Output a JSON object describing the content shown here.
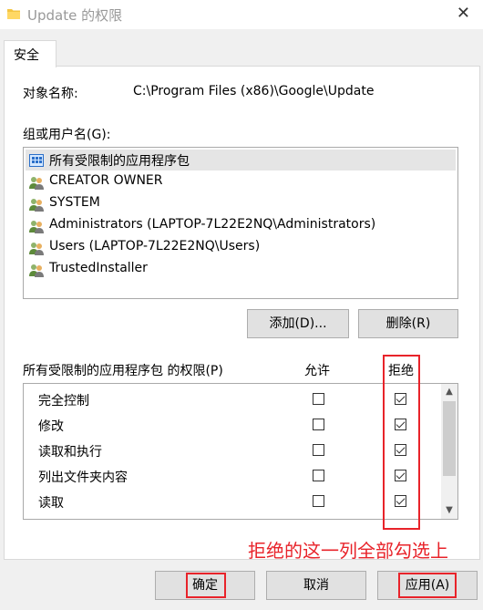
{
  "window": {
    "title": "Update 的权限",
    "close_glyph": "✕"
  },
  "tab": {
    "label": "安全"
  },
  "object": {
    "label": "对象名称:",
    "path": "C:\\Program Files (x86)\\Google\\Update"
  },
  "users": {
    "label": "组或用户名(G):",
    "items": [
      {
        "name": "所有受限制的应用程序包",
        "icon": "app-package-icon",
        "selected": true
      },
      {
        "name": "CREATOR OWNER",
        "icon": "users-group-icon"
      },
      {
        "name": "SYSTEM",
        "icon": "users-group-icon"
      },
      {
        "name": "Administrators (LAPTOP-7L22E2NQ\\Administrators)",
        "icon": "users-group-icon"
      },
      {
        "name": "Users (LAPTOP-7L22E2NQ\\Users)",
        "icon": "users-group-icon"
      },
      {
        "name": "TrustedInstaller",
        "icon": "users-group-icon"
      }
    ]
  },
  "buttons": {
    "add": "添加(D)...",
    "remove": "删除(R)",
    "ok": "确定",
    "cancel": "取消",
    "apply": "应用(A)"
  },
  "permissions": {
    "label": "所有受限制的应用程序包 的权限(P)",
    "allow_header": "允许",
    "deny_header": "拒绝",
    "rows": [
      {
        "name": "完全控制",
        "allow": false,
        "deny": true
      },
      {
        "name": "修改",
        "allow": false,
        "deny": true
      },
      {
        "name": "读取和执行",
        "allow": false,
        "deny": true
      },
      {
        "name": "列出文件夹内容",
        "allow": false,
        "deny": true
      },
      {
        "name": "读取",
        "allow": false,
        "deny": true
      }
    ]
  },
  "annotation": {
    "text": "拒绝的这一列全部勾选上",
    "color": "#e8232a"
  }
}
